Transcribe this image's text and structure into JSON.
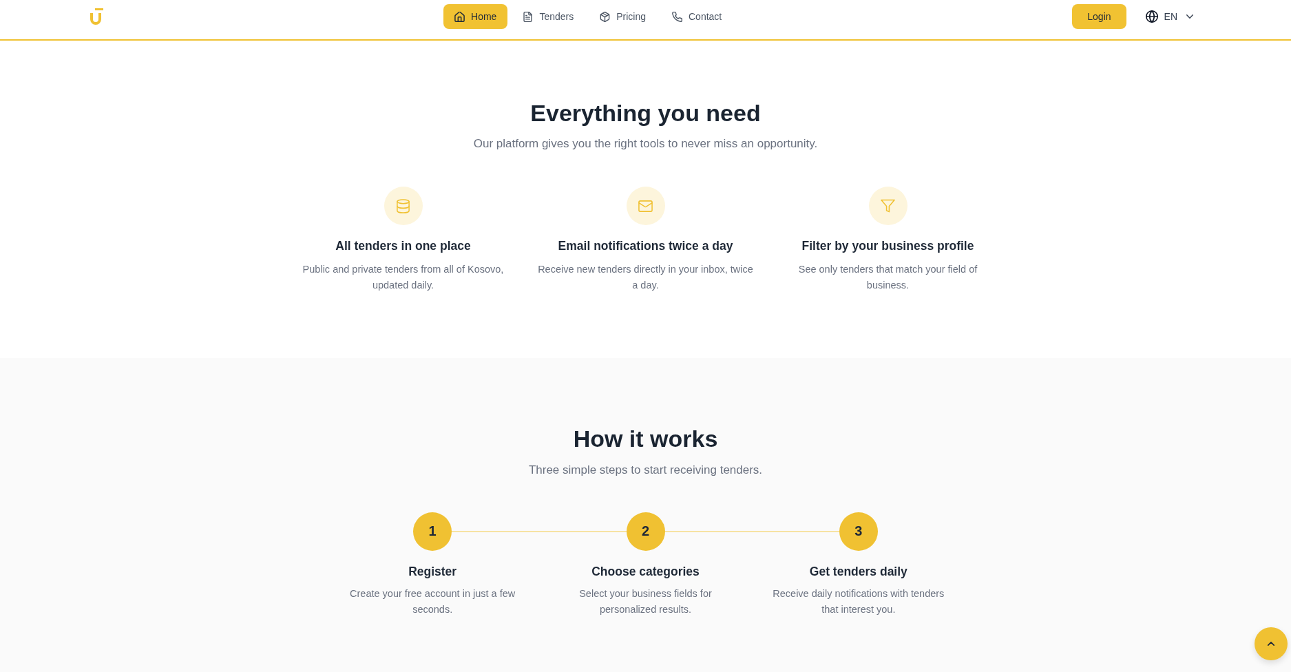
{
  "header": {
    "nav": [
      {
        "label": "Home",
        "selected": true
      },
      {
        "label": "Tenders",
        "selected": false
      },
      {
        "label": "Pricing",
        "selected": false
      },
      {
        "label": "Contact",
        "selected": false
      }
    ],
    "login": "Login",
    "language": "EN"
  },
  "features": {
    "title": "Everything you need",
    "subtitle": "Our platform gives you the right tools to never miss an opportunity.",
    "items": [
      {
        "title": "All tenders in one place",
        "text": "Public and private tenders from all of Kosovo, updated daily."
      },
      {
        "title": "Email notifications twice a day",
        "text": "Receive new tenders directly in your inbox, twice a day."
      },
      {
        "title": "Filter by your business profile",
        "text": "See only tenders that match your field of business."
      }
    ]
  },
  "how_it_works": {
    "title": "How it works",
    "subtitle": "Three simple steps to start receiving tenders.",
    "steps": [
      {
        "number": "1",
        "title": "Register",
        "text": "Create your free account in just a few seconds."
      },
      {
        "number": "2",
        "title": "Choose categories",
        "text": "Select your business fields for personalized results."
      },
      {
        "number": "3",
        "title": "Get tenders daily",
        "text": "Receive daily notifications with tenders that interest you."
      }
    ]
  }
}
